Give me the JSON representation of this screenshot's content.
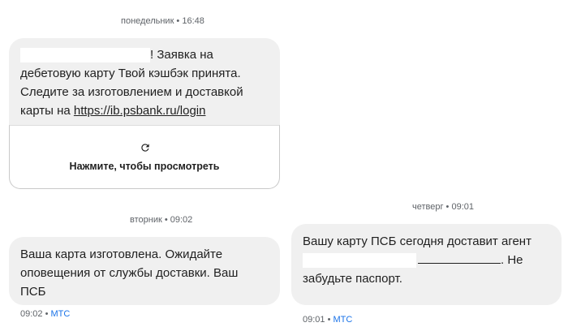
{
  "messages": [
    {
      "timestamp": "понедельник • 16:48",
      "line1_tail": "! Заявка на",
      "line2": "дебетовую карту Твой кэшбэк принята.",
      "line3": "Следите за изготовлением и доставкой",
      "line4_prefix": "карты на ",
      "link": "https://ib.psbank.ru/login",
      "preview_label": "Нажмите, чтобы просмотреть",
      "preview_icon": "refresh-icon"
    },
    {
      "timestamp": "вторник • 09:02",
      "line1": "Ваша карта изготовлена. Ожидайте",
      "line2": "оповещения от службы доставки. Ваш",
      "line3": "ПСБ",
      "meta_time": "09:02",
      "meta_sep": "•",
      "meta_sender": "МТС"
    },
    {
      "timestamp": "четверг • 09:01",
      "line1": "Вашу карту ПСБ сегодня доставит агент",
      "line2_tail": ". Не",
      "line3": "забудьте паспорт.",
      "meta_time": "09:01",
      "meta_sep": "•",
      "meta_sender": "МТС"
    }
  ],
  "colors": {
    "bubble": "#f0f0f0",
    "meta_sender": "#1a73e8",
    "timestamp": "#5f6368"
  }
}
